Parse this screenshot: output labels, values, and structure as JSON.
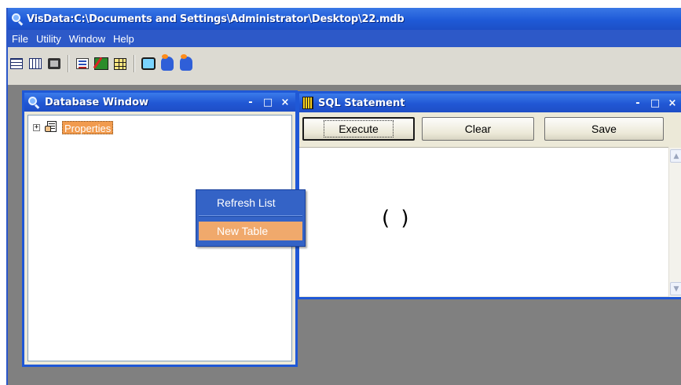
{
  "app": {
    "title": "VisData:C:\\Documents and Settings\\Administrator\\Desktop\\22.mdb",
    "icon": "visdata-magnifier-icon"
  },
  "menubar": {
    "items": [
      "File",
      "Utility",
      "Window",
      "Help"
    ]
  },
  "toolbar": {
    "buttons": [
      {
        "icon": "table-grid-icon"
      },
      {
        "icon": "dynaset-grid-icon"
      },
      {
        "icon": "snapshot-icon"
      },
      {
        "icon": "form-icon"
      },
      {
        "icon": "data-control-icon"
      },
      {
        "icon": "dbgrid-icon"
      },
      {
        "icon": "begin-transaction-icon"
      },
      {
        "icon": "commit-icon"
      },
      {
        "icon": "rollback-icon"
      }
    ]
  },
  "database_window": {
    "title": "Database Window",
    "controls": {
      "minimize": "-",
      "maximize": "□",
      "close": "×"
    },
    "tree": [
      {
        "expander": "+",
        "icon": "properties-icon",
        "label": "Properties",
        "selected": true
      }
    ]
  },
  "context_menu": {
    "items": [
      {
        "label": "Refresh List",
        "highlighted": false
      },
      {
        "label": "New Table",
        "highlighted": true
      }
    ]
  },
  "sql_window": {
    "title": "SQL Statement",
    "controls": {
      "minimize": "-",
      "maximize": "□",
      "close": "×"
    },
    "buttons": {
      "execute": "Execute",
      "clear": "Clear",
      "save": "Save"
    },
    "text": "( )"
  },
  "colors": {
    "titlebar": "#2157d4",
    "menubar": "#2d59c8",
    "toolbar": "#dcdad2",
    "mdi_background": "#808080",
    "selection": "#f19b4e",
    "context_menu": "#3463c6"
  }
}
